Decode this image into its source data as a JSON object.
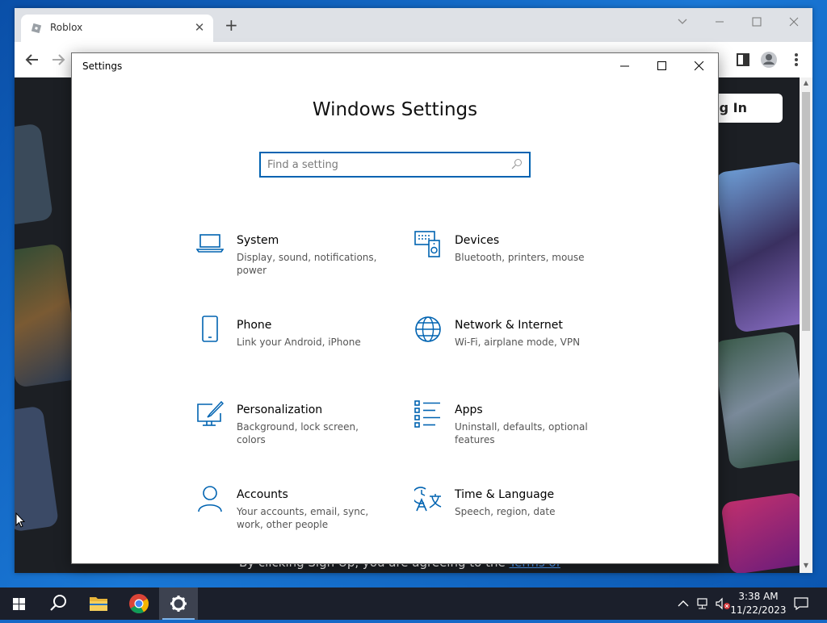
{
  "browser": {
    "tab_title": "Roblox",
    "new_tab_label": "+",
    "tab_close": "✕",
    "page": {
      "login_label": "Log In",
      "footer_text": "By clicking Sign Up, you are agreeing to the ",
      "footer_link": "Terms of"
    }
  },
  "settings": {
    "window_title": "Settings",
    "heading": "Windows Settings",
    "search_placeholder": "Find a setting",
    "accent_color": "#0063b1",
    "items": [
      {
        "name": "System",
        "desc": "Display, sound, notifications, power",
        "icon": "laptop-icon"
      },
      {
        "name": "Devices",
        "desc": "Bluetooth, printers, mouse",
        "icon": "devices-icon"
      },
      {
        "name": "Phone",
        "desc": "Link your Android, iPhone",
        "icon": "phone-icon"
      },
      {
        "name": "Network & Internet",
        "desc": "Wi-Fi, airplane mode, VPN",
        "icon": "globe-icon"
      },
      {
        "name": "Personalization",
        "desc": "Background, lock screen, colors",
        "icon": "paint-icon"
      },
      {
        "name": "Apps",
        "desc": "Uninstall, defaults, optional features",
        "icon": "apps-list-icon"
      },
      {
        "name": "Accounts",
        "desc": "Your accounts, email, sync, work, other people",
        "icon": "person-icon"
      },
      {
        "name": "Time & Language",
        "desc": "Speech, region, date",
        "icon": "time-language-icon"
      }
    ]
  },
  "taskbar": {
    "time": "3:38 AM",
    "date": "11/22/2023"
  }
}
